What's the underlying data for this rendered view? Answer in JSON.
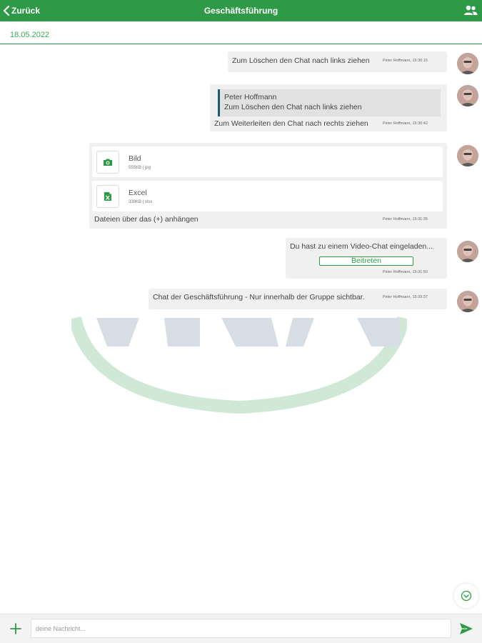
{
  "header": {
    "back_label": "Zurück",
    "title": "Geschäftsführung",
    "group_icon": "group-icon"
  },
  "date_separator": "18.05.2022",
  "colors": {
    "brand_green": "#2e9a47",
    "bubble_bg": "#f0f0f0",
    "quote_bar": "#1d5a74"
  },
  "messages": [
    {
      "text": "Zum Löschen den Chat nach links ziehen",
      "meta": "Peter Hoffmann, 15:30:15"
    },
    {
      "quote_author": "Peter Hoffmann",
      "quote_text": "Zum Löschen den Chat nach links ziehen",
      "text": "Zum Weiterleiten den Chat nach rechts ziehen",
      "meta": "Peter Hoffmann, 15:30:42"
    },
    {
      "files": [
        {
          "name": "Bild",
          "size": "555KB | jpg",
          "icon": "camera-icon"
        },
        {
          "name": "Excel",
          "size": "339KB | xlsx",
          "icon": "excel-file-icon"
        }
      ],
      "text": "Dateien über das (+) anhängen",
      "meta": "Peter Hoffmann, 15:31:35"
    },
    {
      "text": "Du hast zu einem Video-Chat eingeladen...",
      "button_label": "Beitreten",
      "meta": "Peter Hoffmann, 15:31:50"
    },
    {
      "text": "Chat der Geschäftsführung - Nur innerhalb der Gruppe sichtbar.",
      "meta": "Peter Hoffmann, 15:33:37"
    }
  ],
  "composer": {
    "placeholder": "deine Nachricht...",
    "plus_icon": "plus-icon",
    "send_icon": "send-icon"
  },
  "scroll_icon": "chevron-down-circle-icon"
}
